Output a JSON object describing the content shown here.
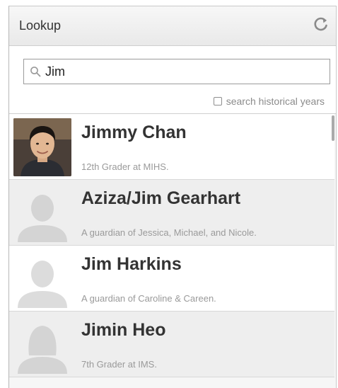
{
  "header": {
    "title": "Lookup",
    "refresh_icon": "refresh-icon"
  },
  "search": {
    "value": "Jim",
    "icon": "search-icon",
    "historical_label": "search historical years",
    "historical_checked": false
  },
  "results": [
    {
      "name": "Jimmy Chan",
      "subtitle": "12th Grader at MIHS.",
      "avatar": "photo",
      "highlighted": false
    },
    {
      "name": "Aziza/Jim Gearhart",
      "subtitle": "A guardian of Jessica, Michael, and Nicole.",
      "avatar": "silhouette-icon",
      "highlighted": true
    },
    {
      "name": "Jim Harkins",
      "subtitle": "A guardian of Caroline & Careen.",
      "avatar": "silhouette-icon",
      "highlighted": false
    },
    {
      "name": "Jimin Heo",
      "subtitle": "7th Grader at IMS.",
      "avatar": "silhouette-female-icon",
      "highlighted": true
    }
  ]
}
